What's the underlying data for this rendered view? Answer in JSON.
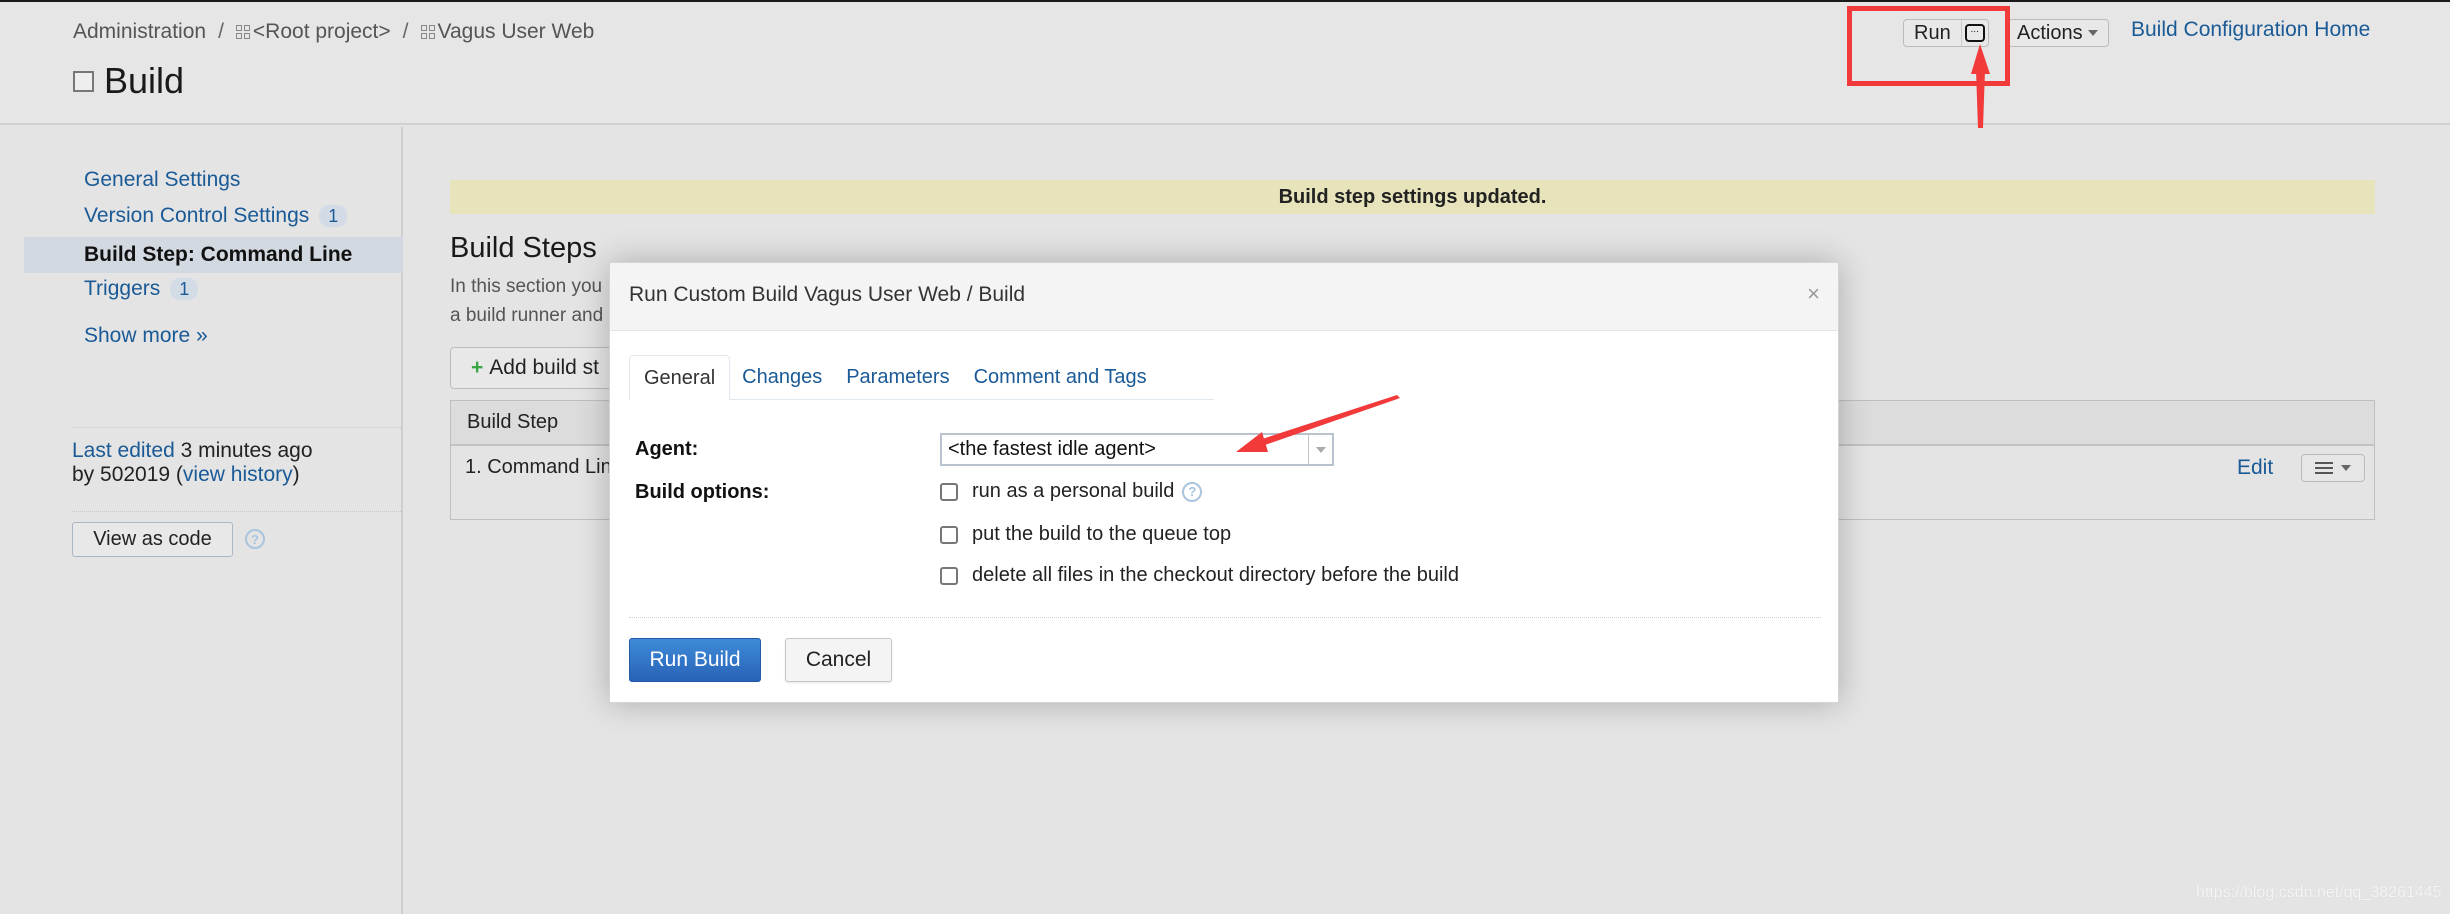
{
  "header": {
    "breadcrumb": [
      {
        "label": "Administration",
        "icon": null
      },
      {
        "label": "<Root project>",
        "icon": "project-icon"
      },
      {
        "label": "Vagus User Web",
        "icon": "project-icon"
      }
    ],
    "separator": "/",
    "page_title": "Build",
    "run_label": "Run",
    "run_more_label": "...",
    "actions_label": "Actions",
    "home_link": "Build Configuration Home"
  },
  "sidebar": {
    "items": [
      {
        "label": "General Settings",
        "badge": null,
        "active": false
      },
      {
        "label": "Version Control Settings",
        "badge": "1",
        "active": false
      },
      {
        "label": "Build Step: Command Line",
        "badge": null,
        "active": true
      },
      {
        "label": "Triggers",
        "badge": "1",
        "active": false
      }
    ],
    "show_more": "Show more »",
    "last_edited_label": "Last edited",
    "last_edited_time": " 3 minutes ago",
    "by_label": "by 502019  (",
    "view_history": "view history",
    "close_paren": ")",
    "view_as_code": "View as code",
    "help_glyph": "?"
  },
  "main": {
    "banner": "Build step settings updated.",
    "section_title": "Build Steps",
    "desc_line1": "In this section you",
    "desc_line2": "a build runner and",
    "add_step_plus": "+",
    "add_step_label": "Add build st",
    "table": {
      "header": "Build Step",
      "rows": [
        {
          "name": "1. Command Lin",
          "edit": "Edit"
        }
      ]
    }
  },
  "dialog": {
    "title": "Run Custom Build Vagus User Web / Build",
    "close_glyph": "×",
    "tabs": [
      {
        "label": "General",
        "active": true
      },
      {
        "label": "Changes",
        "active": false
      },
      {
        "label": "Parameters",
        "active": false
      },
      {
        "label": "Comment and Tags",
        "active": false
      }
    ],
    "agent_label": "Agent:",
    "agent_value": "<the fastest idle agent>",
    "build_options_label": "Build options:",
    "options": [
      {
        "label": "run as a personal build",
        "checked": false,
        "help": "?"
      },
      {
        "label": "put the build to the queue top",
        "checked": false
      },
      {
        "label": "delete all files in the checkout directory before the build",
        "checked": false
      }
    ],
    "run_build": "Run Build",
    "cancel": "Cancel"
  },
  "watermark": "https://blog.csdn.net/qq_38261445",
  "colors": {
    "link": "#1a5a96",
    "primary_button": "#2d6fc4",
    "banner": "#e7e4bc",
    "annotation": "#f23a3a"
  }
}
